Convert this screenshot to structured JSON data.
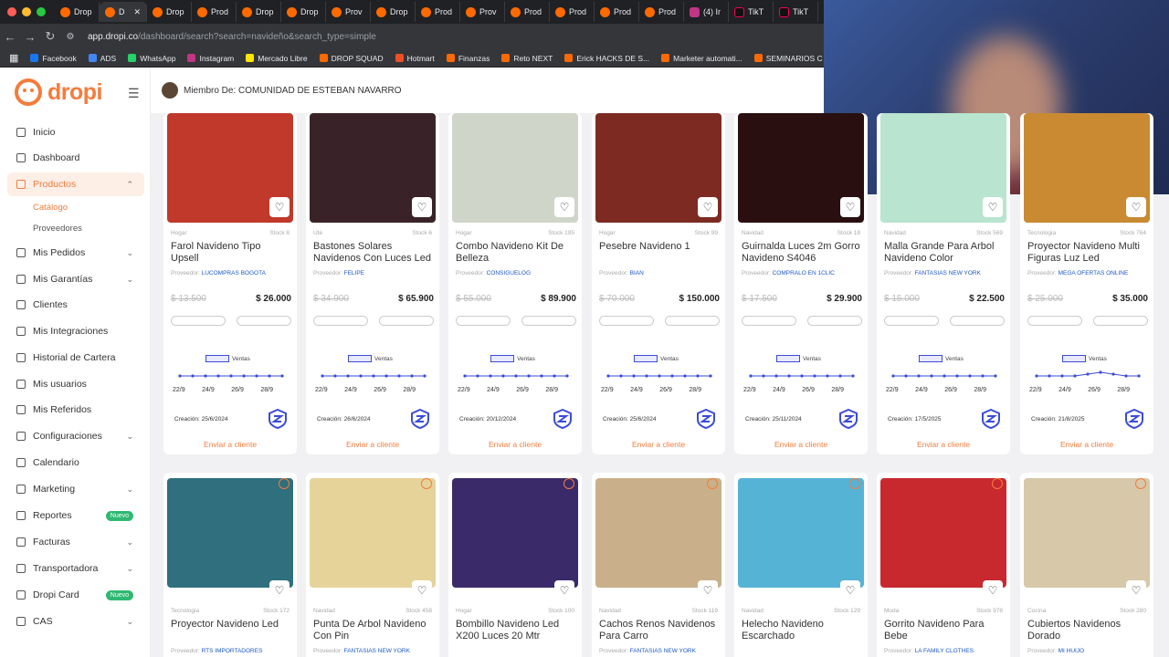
{
  "browser": {
    "tabs": [
      {
        "label": "Drop",
        "icon": "dropi-favicon"
      },
      {
        "label": "D",
        "icon": "dropi-favicon",
        "active": true
      },
      {
        "label": "Drop",
        "icon": "dropi-favicon"
      },
      {
        "label": "Prod",
        "icon": "dropi-favicon"
      },
      {
        "label": "Drop",
        "icon": "dropi-favicon"
      },
      {
        "label": "Drop",
        "icon": "dropi-favicon"
      },
      {
        "label": "Prov",
        "icon": "dropi-favicon"
      },
      {
        "label": "Drop",
        "icon": "dropi-favicon"
      },
      {
        "label": "Prod",
        "icon": "dropi-favicon"
      },
      {
        "label": "Prov",
        "icon": "dropi-favicon"
      },
      {
        "label": "Prod",
        "icon": "dropi-favicon"
      },
      {
        "label": "Prod",
        "icon": "dropi-favicon"
      },
      {
        "label": "Prod",
        "icon": "dropi-favicon"
      },
      {
        "label": "Prod",
        "icon": "dropi-favicon"
      },
      {
        "label": "(4) Ir",
        "icon": "instagram-favicon"
      },
      {
        "label": "TikT",
        "icon": "tiktok-favicon"
      },
      {
        "label": "TikT",
        "icon": "tiktok-favicon"
      }
    ],
    "url_host": "app.dropi.co",
    "url_path": "/dashboard/search?search=navideño&search_type=simple",
    "bookmarks": [
      {
        "label": "Facebook",
        "color": "#1877f2"
      },
      {
        "label": "ADS",
        "color": "#4285f4"
      },
      {
        "label": "WhatsApp",
        "color": "#25d366"
      },
      {
        "label": "Instagram",
        "color": "#c13584"
      },
      {
        "label": "Mercado Libre",
        "color": "#ffe600"
      },
      {
        "label": "DROP SQUAD",
        "color": "#ff6a00"
      },
      {
        "label": "Hotmart",
        "color": "#f04e23"
      },
      {
        "label": "Finanzas",
        "color": "#ff6a00"
      },
      {
        "label": "Reto NEXT",
        "color": "#ff6a00"
      },
      {
        "label": "Erick HACKS DE S...",
        "color": "#ff6a00"
      },
      {
        "label": "Marketer automati...",
        "color": "#ff6a00"
      },
      {
        "label": "SEMINARIOS C",
        "color": "#ff6a00"
      }
    ]
  },
  "brand": {
    "logo_text": "dropi",
    "accent": "#f47c3c"
  },
  "topbar": {
    "member_label": "Miembro De: COMUNIDAD DE ESTEBAN NAVARRO"
  },
  "sidebar": {
    "items": [
      {
        "label": "Inicio",
        "icon": "home-icon"
      },
      {
        "label": "Dashboard",
        "icon": "dashboard-icon"
      },
      {
        "label": "Productos",
        "icon": "tag-icon",
        "active": true,
        "chevron": "up"
      },
      {
        "label": "Mis Pedidos",
        "icon": "cart-icon",
        "chevron": "down"
      },
      {
        "label": "Mis Garantías",
        "icon": "shield-icon",
        "chevron": "down"
      },
      {
        "label": "Clientes",
        "icon": "users-icon"
      },
      {
        "label": "Mis Integraciones",
        "icon": "plug-icon"
      },
      {
        "label": "Historial de Cartera",
        "icon": "wallet-icon"
      },
      {
        "label": "Mis usuarios",
        "icon": "user-icon"
      },
      {
        "label": "Mis Referidos",
        "icon": "referral-icon"
      },
      {
        "label": "Configuraciones",
        "icon": "gear-icon",
        "chevron": "down"
      },
      {
        "label": "Calendario",
        "icon": "calendar-icon"
      },
      {
        "label": "Marketing",
        "icon": "megaphone-icon",
        "chevron": "down"
      },
      {
        "label": "Reportes",
        "icon": "report-icon",
        "badge": "Nuevo"
      },
      {
        "label": "Facturas",
        "icon": "invoice-icon",
        "chevron": "down"
      },
      {
        "label": "Transportadora",
        "icon": "truck-icon",
        "chevron": "down"
      },
      {
        "label": "Dropi Card",
        "icon": "card-icon",
        "badge": "Nuevo"
      },
      {
        "label": "CAS",
        "icon": "cas-icon",
        "chevron": "down"
      }
    ],
    "subitems": [
      {
        "label": "Catálogo",
        "active": true
      },
      {
        "label": "Proveedores"
      }
    ]
  },
  "products_row1": [
    {
      "category": "Hogar",
      "stock": "Stock 8",
      "title": "Farol Navideno Tipo Upsell",
      "provider": "LUCOMPRAS BOGOTA",
      "old_price": "$ 13.500",
      "price": "$ 26.000",
      "sales_label": "Ventas",
      "dates": [
        "22/9",
        "24/9",
        "26/9",
        "28/9"
      ],
      "created": "Creación: 25/6/2024",
      "cta": "Enviar a cliente",
      "thumb": "#c0392b"
    },
    {
      "category": "Ute",
      "stock": "Stock 6",
      "title": "Bastones Solares Navidenos Con Luces Led",
      "provider": "FELIPE",
      "old_price": "$ 34.900",
      "price": "$ 65.900",
      "sales_label": "Ventas",
      "dates": [
        "22/9",
        "24/9",
        "26/9",
        "28/9"
      ],
      "created": "Creación: 26/6/2024",
      "cta": "Enviar a cliente",
      "thumb": "#3a2328"
    },
    {
      "category": "Hogar",
      "stock": "Stock 195",
      "title": "Combo Navideno Kit De Belleza",
      "provider": "CONSIGUELOG",
      "old_price": "$ 55.000",
      "price": "$ 89.900",
      "sales_label": "Ventas",
      "dates": [
        "22/9",
        "24/9",
        "26/9",
        "28/9"
      ],
      "created": "Creación: 20/12/2024",
      "cta": "Enviar a cliente",
      "thumb": "#cfd6c9"
    },
    {
      "category": "Hogar",
      "stock": "Stock 99",
      "title": "Pesebre Navideno 1",
      "provider": "BIAN",
      "old_price": "$ 70.000",
      "price": "$ 150.000",
      "sales_label": "Ventas",
      "dates": [
        "22/9",
        "24/9",
        "26/9",
        "28/9"
      ],
      "created": "Creación: 25/6/2024",
      "cta": "Enviar a cliente",
      "thumb": "#7d2b22"
    },
    {
      "category": "Navidad",
      "stock": "Stock 18",
      "title": "Guirnalda Luces 2m Gorro Navideno S4046",
      "provider": "COMPRALO EN 1CLIC",
      "old_price": "$ 17.500",
      "price": "$ 29.900",
      "sales_label": "Ventas",
      "dates": [
        "22/9",
        "24/9",
        "26/9",
        "28/9"
      ],
      "created": "Creación: 25/11/2024",
      "cta": "Enviar a cliente",
      "thumb": "#2a0f10"
    },
    {
      "category": "Navidad",
      "stock": "Stock 569",
      "title": "Malla Grande Para Arbol Navideno Color",
      "provider": "FANTASIAS NEW YORK",
      "old_price": "$ 15.000",
      "price": "$ 22.500",
      "sales_label": "Ventas",
      "dates": [
        "22/9",
        "24/9",
        "26/9",
        "28/9"
      ],
      "created": "Creación: 17/5/2025",
      "cta": "Enviar a cliente",
      "thumb": "#b8e4d0"
    },
    {
      "category": "Tecnologia",
      "stock": "Stock 764",
      "title": "Proyector Navideno Multi Figuras Luz Led",
      "provider": "MEGA OFERTAS ONLINE",
      "old_price": "$ 25.000",
      "price": "$ 35.000",
      "sales_label": "Ventas",
      "dates": [
        "22/9",
        "24/9",
        "26/9",
        "28/9"
      ],
      "created": "Creación: 21/8/2025",
      "cta": "Enviar a cliente",
      "thumb": "#c98a32"
    }
  ],
  "products_row2": [
    {
      "category": "Tecnologia",
      "stock": "Stock 172",
      "title": "Proyector Navideno Led",
      "provider": "RTS IMPORTADORES",
      "thumb": "#2f6f7e"
    },
    {
      "category": "Navidad",
      "stock": "Stock 458",
      "title": "Punta De Arbol Navideno Con Pin",
      "provider": "FANTASIAS NEW YORK",
      "thumb": "#e6d39a"
    },
    {
      "category": "Hogar",
      "stock": "Stock 100",
      "title": "Bombillo Navideno Led X200 Luces 20 Mtr",
      "provider": "",
      "thumb": "#3a2a6a"
    },
    {
      "category": "Navidad",
      "stock": "Stock 119",
      "title": "Cachos Renos Navidenos Para Carro",
      "provider": "FANTASIAS NEW YORK",
      "thumb": "#c9b08a"
    },
    {
      "category": "Navidad",
      "stock": "Stock 129",
      "title": "Helecho Navideno Escarchado",
      "provider": "",
      "thumb": "#55b3d6"
    },
    {
      "category": "Moda",
      "stock": "Stock 978",
      "title": "Gorrito Navideno Para Bebe",
      "provider": "LA FAMILY CLOTHES",
      "thumb": "#c7292f"
    },
    {
      "category": "Cocina",
      "stock": "Stock 280",
      "title": "Cubiertos Navidenos Dorado",
      "provider": "MI HUIJO",
      "thumb": "#d6c8a8"
    }
  ]
}
